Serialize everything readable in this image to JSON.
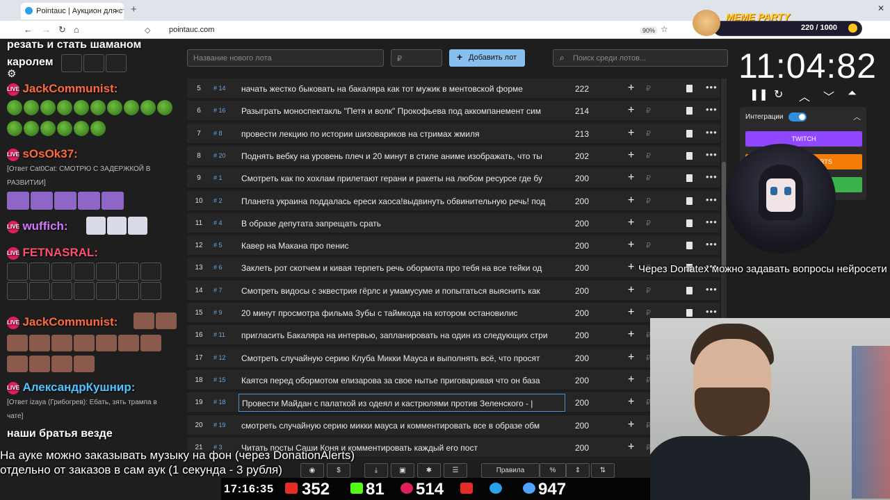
{
  "browser": {
    "tab_title": "Pointauc | Аукцион для стримеров",
    "url": "pointauc.com",
    "zoom": "90%"
  },
  "meme_party": {
    "title": "MEME PARTY",
    "score": "220 / 1000"
  },
  "chat": {
    "line1": "резать и стать шаманом",
    "line2": "каролем",
    "m1_nick": "JackCommunist:",
    "m2_nick": "sOsOk37:",
    "m2_reply": "[Ответ Cat0Cat: СМОТРЮ С ЗАДЕРЖКОЙ В РАЗВИТИИ]",
    "m3_nick": "wuffich:",
    "m4_nick": "FETNASRAL:",
    "m5_nick": "JackCommunist:",
    "m6_nick": "АлександрКушнир:",
    "m6_reply": "[Ответ izaya (Грибогрев): Ебать, зять трампа в чате]",
    "m7_text": "наши братья везде"
  },
  "toolbar": {
    "new_lot_placeholder": "Название нового лота",
    "amount_placeholder": "₽",
    "add_button": "Добавить лот",
    "search_placeholder": "Поиск среди лотов..."
  },
  "lots": [
    {
      "n": "5",
      "tag": "# 14",
      "title": "начать жестко быковать на бакаляра как тот мужик в ментовской форме",
      "amount": "222"
    },
    {
      "n": "6",
      "tag": "# 16",
      "title": "Разыграть моноспектакль \"Петя и волк\" Прокофьева под аккомпанемент сим",
      "amount": "214"
    },
    {
      "n": "7",
      "tag": "# 8",
      "title": "провести лекцию по истории шизовариков на стримах жмиля",
      "amount": "213"
    },
    {
      "n": "8",
      "tag": "# 20",
      "title": "Поднять вебку на уровень плеч и 20 минут в стиле аниме изображать, что ты",
      "amount": "202"
    },
    {
      "n": "9",
      "tag": "# 1",
      "title": "Смотреть как по хохлам прилетают герани и ракеты на любом ресурсе где бу",
      "amount": "200"
    },
    {
      "n": "10",
      "tag": "# 2",
      "title": "Планета украина поддалась ереси хаоса!выдвинуть обвинительную речь! под",
      "amount": "200"
    },
    {
      "n": "11",
      "tag": "# 4",
      "title": "В образе депутата запрещать срать",
      "amount": "200"
    },
    {
      "n": "12",
      "tag": "# 5",
      "title": "Кавер на Макана про пенис",
      "amount": "200"
    },
    {
      "n": "13",
      "tag": "# 6",
      "title": "Заклеть рот скотчем и кивая терпеть речь обормота про тебя на все тейки од",
      "amount": "200"
    },
    {
      "n": "14",
      "tag": "# 7",
      "title": "Смотреть видосы с эквестрия гёрлс и умамусуме и попытаться выяснить как",
      "amount": "200"
    },
    {
      "n": "15",
      "tag": "# 9",
      "title": "20 минут просмотра фильма Зубы с таймкода на котором остановилис",
      "amount": "200"
    },
    {
      "n": "16",
      "tag": "# 11",
      "title": "пригласить Бакаляра на интервью, запланировать на один из следующих стри",
      "amount": "200"
    },
    {
      "n": "17",
      "tag": "# 12",
      "title": "Смотреть случайную серию Клуба Микки Мауса и выполнять всё, что просят",
      "amount": "200"
    },
    {
      "n": "18",
      "tag": "# 15",
      "title": "Каятся перед обормотом елизарова за свое нытье приговаривая что он база",
      "amount": "200"
    },
    {
      "n": "19",
      "tag": "# 18",
      "title": "Провести Майдан с палаткой из одеял и кастрюлями против Зеленского - |",
      "amount": "200"
    },
    {
      "n": "20",
      "tag": "# 19",
      "title": "смотреть случайную серию микки мауса и комментировать все в образе обм",
      "amount": "200"
    },
    {
      "n": "21",
      "tag": "# 3",
      "title": "Читать посты Саши Коня и комментировать каждый его пост",
      "amount": "200"
    }
  ],
  "timer": {
    "value": "11:04:82"
  },
  "integrations": {
    "label": "Интеграции",
    "twitch": "TWITCH",
    "donationalerts": "DONATIONALERTS",
    "third": ""
  },
  "bottom": {
    "rules": "Правила",
    "percent": "%"
  },
  "ticker": {
    "donatex": "Через Donatex можно задавать вопросы нейросети",
    "music1": "На ауке можно заказывать музыку на фон (через DonationAlerts)",
    "music2": "отдельно от заказов в сам аук (1 секунда - 3 рубля)"
  },
  "status": {
    "clock": "17:16:35",
    "youtube": "352",
    "kick": "81",
    "live": "514",
    "total": "947"
  },
  "colors": {
    "accent": "#87c0ee",
    "twitch": "#9147ff",
    "donationalerts": "#f57d07",
    "green": "#3cb34a"
  }
}
